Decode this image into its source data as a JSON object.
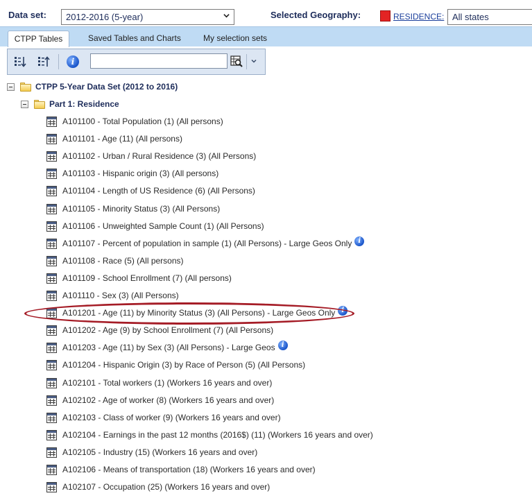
{
  "topbar": {
    "dataset_label": "Data set:",
    "dataset_value": "2012-2016 (5-year)",
    "geography_label": "Selected Geography:",
    "residence_link": "RESIDENCE:",
    "residence_color": "#e32424",
    "state_value": "All states"
  },
  "tabs": [
    {
      "label": "CTPP Tables",
      "active": true
    },
    {
      "label": "Saved Tables and Charts",
      "active": false
    },
    {
      "label": "My selection sets",
      "active": false
    }
  ],
  "toolbar": {
    "icons": [
      "sort-descending-icon",
      "sort-ascending-icon",
      "info-icon",
      "search-table-icon",
      "dropdown-chevron-icon"
    ],
    "info_glyph": "i",
    "search_value": ""
  },
  "tree": {
    "root_label": "CTPP 5-Year Data Set (2012 to 2016)",
    "part_label": "Part 1: Residence",
    "items": [
      {
        "text": "A101100 - Total Population (1) (All persons)",
        "info": false
      },
      {
        "text": "A101101 - Age (11) (All persons)",
        "info": false
      },
      {
        "text": "A101102 - Urban / Rural Residence (3) (All Persons)",
        "info": false
      },
      {
        "text": "A101103 - Hispanic origin (3) (All persons)",
        "info": false
      },
      {
        "text": "A101104 - Length of US Residence (6) (All Persons)",
        "info": false
      },
      {
        "text": "A101105 - Minority Status (3) (All Persons)",
        "info": false
      },
      {
        "text": "A101106 - Unweighted Sample Count (1) (All Persons)",
        "info": false
      },
      {
        "text": "A101107 - Percent of population in sample (1) (All Persons) - Large Geos Only",
        "info": true
      },
      {
        "text": "A101108 - Race (5) (All persons)",
        "info": false
      },
      {
        "text": "A101109 - School Enrollment (7) (All persons)",
        "info": false
      },
      {
        "text": "A101110 - Sex (3) (All Persons)",
        "info": false
      },
      {
        "text": "A101201 - Age (11) by Minority Status (3) (All Persons) - Large Geos Only",
        "info": true
      },
      {
        "text": "A101202 - Age (9) by School Enrollment (7) (All Persons)",
        "info": false
      },
      {
        "text": "A101203 - Age (11) by Sex (3) (All Persons) - Large Geos",
        "info": true
      },
      {
        "text": "A101204 - Hispanic Origin (3) by Race of Person (5) (All Persons)",
        "info": false
      },
      {
        "text": "A102101 - Total workers (1) (Workers 16 years and over)",
        "info": false
      },
      {
        "text": "A102102 - Age of worker (8) (Workers 16 years and over)",
        "info": false
      },
      {
        "text": "A102103 - Class of worker (9) (Workers 16 years and over)",
        "info": false
      },
      {
        "text": "A102104 - Earnings in the past 12 months (2016$) (11) (Workers 16 years and over)",
        "info": false
      },
      {
        "text": "A102105 - Industry (15) (Workers 16 years and over)",
        "info": false
      },
      {
        "text": "A102106 - Means of transportation (18) (Workers 16 years and over)",
        "info": false
      },
      {
        "text": "A102107 - Occupation (25) (Workers 16 years and over)",
        "info": false
      }
    ],
    "highlighted_item": "A101201 - Age (11) by Minority Status (3) (All Persons) - Large Geos Only",
    "highlight_color": "#a51c26"
  }
}
